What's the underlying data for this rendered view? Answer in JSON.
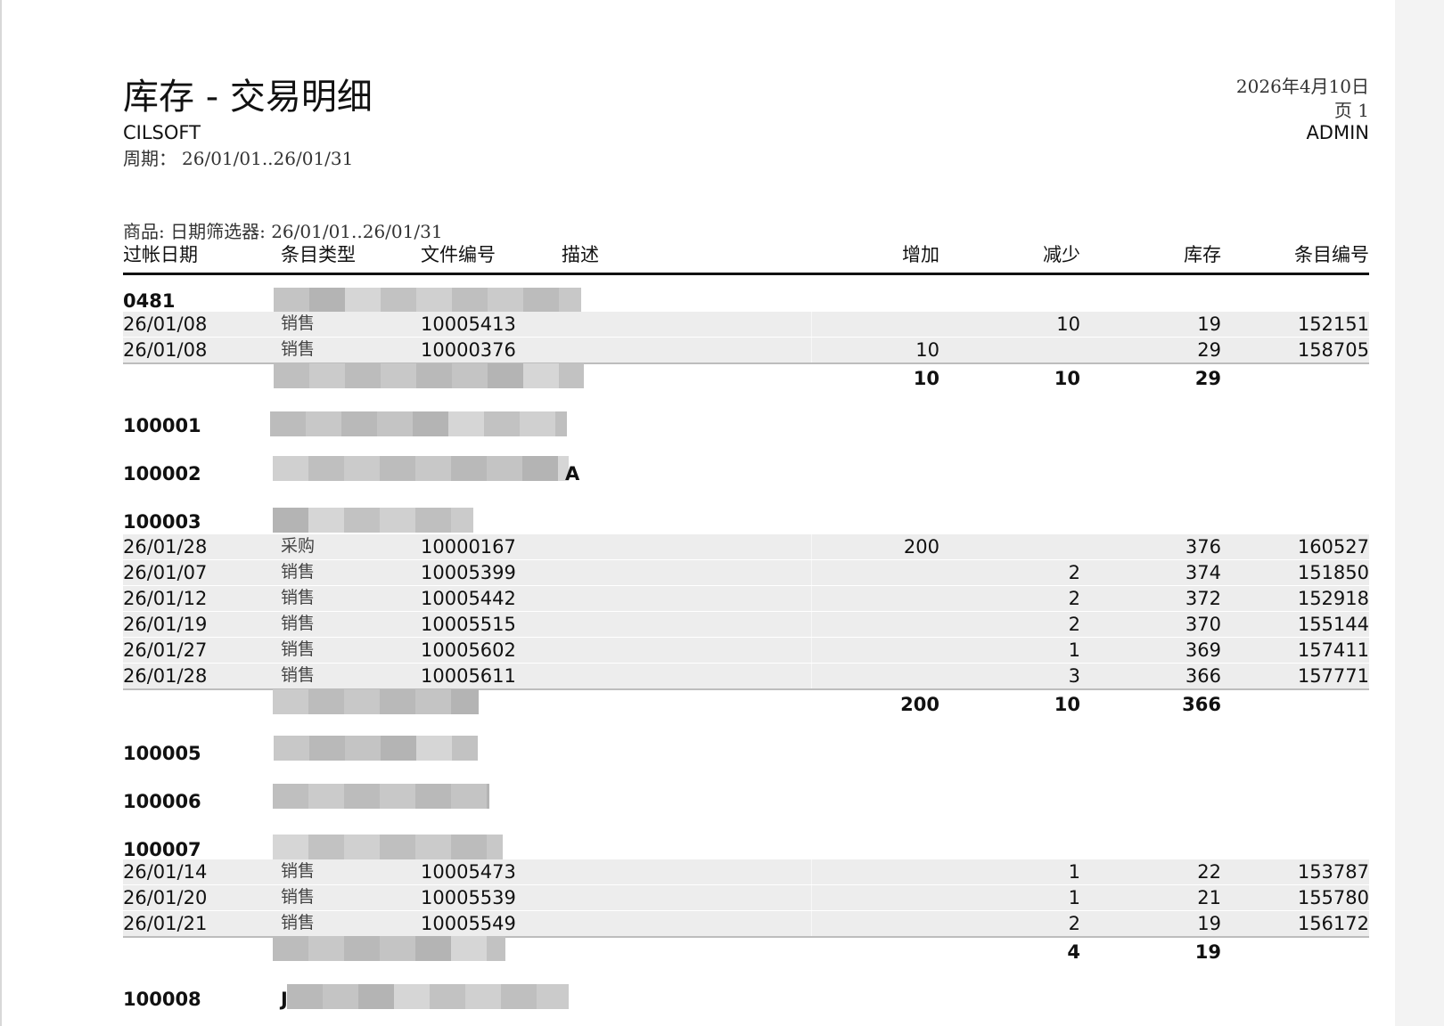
{
  "report": {
    "title": "库存 - 交易明细",
    "company": "CILSOFT",
    "period_label": "周期：",
    "period_value": "26/01/01..26/01/31",
    "date": "2026年4月10日",
    "page": "页 1",
    "user": "ADMIN",
    "filter": "商品: 日期筛选器: 26/01/01..26/01/31"
  },
  "columns": {
    "posting_date": "过帐日期",
    "entry_type": "条目类型",
    "document_no": "文件编号",
    "description": "描述",
    "increase": "增加",
    "decrease": "减少",
    "inventory": "库存",
    "entry_no": "条目编号"
  },
  "groups": [
    {
      "code": "0481",
      "rows": [
        {
          "date": "26/01/08",
          "type": "销售",
          "doc": "10005413",
          "inc": "",
          "dec": "10",
          "inv": "19",
          "entry": "152151"
        },
        {
          "date": "26/01/08",
          "type": "销售",
          "doc": "10000376",
          "inc": "10",
          "dec": "",
          "inv": "29",
          "entry": "158705"
        }
      ],
      "totals": {
        "inc": "10",
        "dec": "10",
        "inv": "29"
      }
    },
    {
      "code": "100001",
      "rows": []
    },
    {
      "code": "100002",
      "rows": [],
      "tail": "A"
    },
    {
      "code": "100003",
      "rows": [
        {
          "date": "26/01/28",
          "type": "采购",
          "doc": "10000167",
          "inc": "200",
          "dec": "",
          "inv": "376",
          "entry": "160527"
        },
        {
          "date": "26/01/07",
          "type": "销售",
          "doc": "10005399",
          "inc": "",
          "dec": "2",
          "inv": "374",
          "entry": "151850"
        },
        {
          "date": "26/01/12",
          "type": "销售",
          "doc": "10005442",
          "inc": "",
          "dec": "2",
          "inv": "372",
          "entry": "152918"
        },
        {
          "date": "26/01/19",
          "type": "销售",
          "doc": "10005515",
          "inc": "",
          "dec": "2",
          "inv": "370",
          "entry": "155144"
        },
        {
          "date": "26/01/27",
          "type": "销售",
          "doc": "10005602",
          "inc": "",
          "dec": "1",
          "inv": "369",
          "entry": "157411"
        },
        {
          "date": "26/01/28",
          "type": "销售",
          "doc": "10005611",
          "inc": "",
          "dec": "3",
          "inv": "366",
          "entry": "157771"
        }
      ],
      "totals": {
        "inc": "200",
        "dec": "10",
        "inv": "366"
      }
    },
    {
      "code": "100005",
      "rows": []
    },
    {
      "code": "100006",
      "rows": []
    },
    {
      "code": "100007",
      "rows": [
        {
          "date": "26/01/14",
          "type": "销售",
          "doc": "10005473",
          "inc": "",
          "dec": "1",
          "inv": "22",
          "entry": "153787"
        },
        {
          "date": "26/01/20",
          "type": "销售",
          "doc": "10005539",
          "inc": "",
          "dec": "1",
          "inv": "21",
          "entry": "155780"
        },
        {
          "date": "26/01/21",
          "type": "销售",
          "doc": "10005549",
          "inc": "",
          "dec": "2",
          "inv": "19",
          "entry": "156172"
        }
      ],
      "totals": {
        "inc": "",
        "dec": "4",
        "inv": "19"
      }
    },
    {
      "code": "100008",
      "rows": [],
      "initial": "J"
    }
  ]
}
